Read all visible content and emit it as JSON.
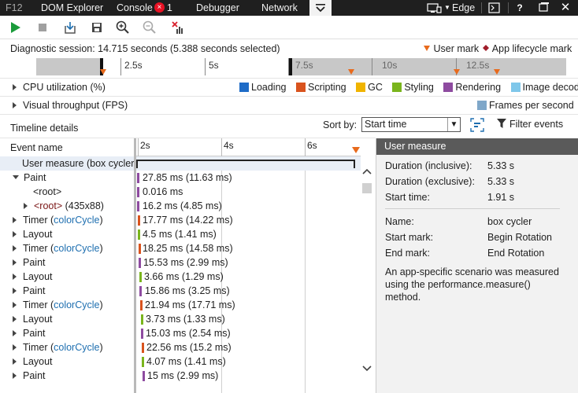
{
  "tabs": {
    "f12": "F12",
    "dom": "DOM Explorer",
    "console": "Console",
    "console_count": "1",
    "debugger": "Debugger",
    "network": "Network",
    "browser": "Edge"
  },
  "session": {
    "text": "Diagnostic session: 14.715 seconds (5.388 seconds selected)"
  },
  "marks": {
    "user": "User mark",
    "app": "App lifecycle mark",
    "user_color": "#e86a1c",
    "app_color": "#a01d2a"
  },
  "ruler": {
    "labels": [
      "2.5s",
      "5s",
      "7.5s",
      "10s",
      "12.5s"
    ]
  },
  "cpu": {
    "label": "CPU utilization (%)"
  },
  "legend": [
    {
      "label": "Loading",
      "color": "#1f6cc7"
    },
    {
      "label": "Scripting",
      "color": "#d9531e"
    },
    {
      "label": "GC",
      "color": "#f0b400"
    },
    {
      "label": "Styling",
      "color": "#7ab51d"
    },
    {
      "label": "Rendering",
      "color": "#8e4ba0"
    },
    {
      "label": "Image decoding",
      "color": "#7fc7ea"
    }
  ],
  "throughput": {
    "label": "Visual throughput (FPS)",
    "legend": "Frames per second",
    "legend_color": "#7fa7c9"
  },
  "timeline": {
    "title": "Timeline details",
    "sort_label": "Sort by:",
    "sort_value": "Start time",
    "filter_label": "Filter events",
    "event_col": "Event name",
    "ticks": [
      "2s",
      "4s",
      "6s"
    ]
  },
  "rows": [
    {
      "name": "User measure (box cycler)",
      "value": "",
      "color": ""
    },
    {
      "name": "Paint",
      "value": "27.85 ms (11.63 ms)",
      "color": "#8e4ba0"
    },
    {
      "name": "<root>",
      "value": "0.016 ms",
      "color": "#8e4ba0"
    },
    {
      "name": "<root>",
      "suffix": " (435x88)",
      "value": "16.2 ms (4.85 ms)",
      "color": "#8e4ba0"
    },
    {
      "name": "Timer (",
      "fn": "colorCycle",
      "close": ")",
      "value": "17.77 ms (14.22 ms)",
      "color": "#d9531e"
    },
    {
      "name": "Layout",
      "value": "4.5 ms (1.41 ms)",
      "color": "#7ab51d"
    },
    {
      "name": "Timer (",
      "fn": "colorCycle",
      "close": ")",
      "value": "18.25 ms (14.58 ms)",
      "color": "#d9531e"
    },
    {
      "name": "Paint",
      "value": "15.53 ms (2.99 ms)",
      "color": "#8e4ba0"
    },
    {
      "name": "Layout",
      "value": "3.66 ms (1.29 ms)",
      "color": "#7ab51d"
    },
    {
      "name": "Paint",
      "value": "15.86 ms (3.25 ms)",
      "color": "#8e4ba0"
    },
    {
      "name": "Timer (",
      "fn": "colorCycle",
      "close": ")",
      "value": "21.94 ms (17.71 ms)",
      "color": "#d9531e"
    },
    {
      "name": "Layout",
      "value": "3.73 ms (1.33 ms)",
      "color": "#7ab51d"
    },
    {
      "name": "Paint",
      "value": "15.03 ms (2.54 ms)",
      "color": "#8e4ba0"
    },
    {
      "name": "Timer (",
      "fn": "colorCycle",
      "close": ")",
      "value": "22.56 ms (15.2 ms)",
      "color": "#d9531e"
    },
    {
      "name": "Layout",
      "value": "4.07 ms (1.41 ms)",
      "color": "#7ab51d"
    },
    {
      "name": "Paint",
      "value": "15 ms (2.99 ms)",
      "color": "#8e4ba0"
    }
  ],
  "details": {
    "title": "User measure",
    "duration_incl_label": "Duration (inclusive):",
    "duration_incl": "5.33 s",
    "duration_excl_label": "Duration (exclusive):",
    "duration_excl": "5.33 s",
    "start_label": "Start time:",
    "start": "1.91 s",
    "name_label": "Name:",
    "name": "box cycler",
    "start_mark_label": "Start mark:",
    "start_mark": "Begin Rotation",
    "end_mark_label": "End mark:",
    "end_mark": "End Rotation",
    "description": "An app-specific scenario was measured using the performance.measure() method."
  }
}
